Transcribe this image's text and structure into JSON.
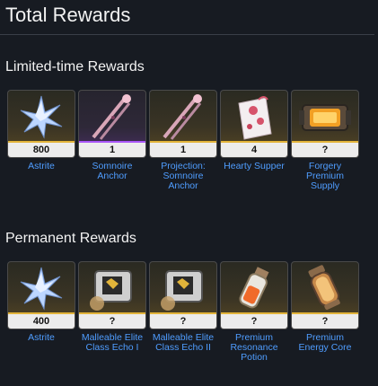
{
  "header": {
    "title": "Total Rewards"
  },
  "sections": [
    {
      "title": "Limited-time Rewards",
      "items": [
        {
          "qty": "800",
          "name": "Astrite",
          "icon": "astrite-crystal-icon",
          "tier": "gold"
        },
        {
          "qty": "1",
          "name": "Somnoire Anchor",
          "icon": "somnoire-anchor-icon",
          "tier": "purple"
        },
        {
          "qty": "1",
          "name": "Projection: Somnoire Anchor",
          "icon": "projection-somnoire-anchor-icon",
          "tier": "gold"
        },
        {
          "qty": "4",
          "name": "Hearty Supper",
          "icon": "hearty-supper-icon",
          "tier": "gold"
        },
        {
          "qty": "?",
          "name": "Forgery Premium Supply",
          "icon": "forgery-premium-supply-icon",
          "tier": "gold"
        }
      ]
    },
    {
      "title": "Permanent Rewards",
      "items": [
        {
          "qty": "400",
          "name": "Astrite",
          "icon": "astrite-crystal-icon",
          "tier": "gold"
        },
        {
          "qty": "?",
          "name": "Malleable Elite Class Echo I",
          "icon": "echo-box-icon",
          "tier": "gold"
        },
        {
          "qty": "?",
          "name": "Malleable Elite Class Echo II",
          "icon": "echo-box-icon",
          "tier": "gold"
        },
        {
          "qty": "?",
          "name": "Premium Resonance Potion",
          "icon": "resonance-potion-icon",
          "tier": "gold"
        },
        {
          "qty": "?",
          "name": "Premium Energy Core",
          "icon": "energy-core-icon",
          "tier": "gold"
        }
      ]
    }
  ],
  "colors": {
    "background": "#171b22",
    "link": "#4f9dff",
    "gold": "#e2b43a",
    "purple": "#a855f7"
  }
}
